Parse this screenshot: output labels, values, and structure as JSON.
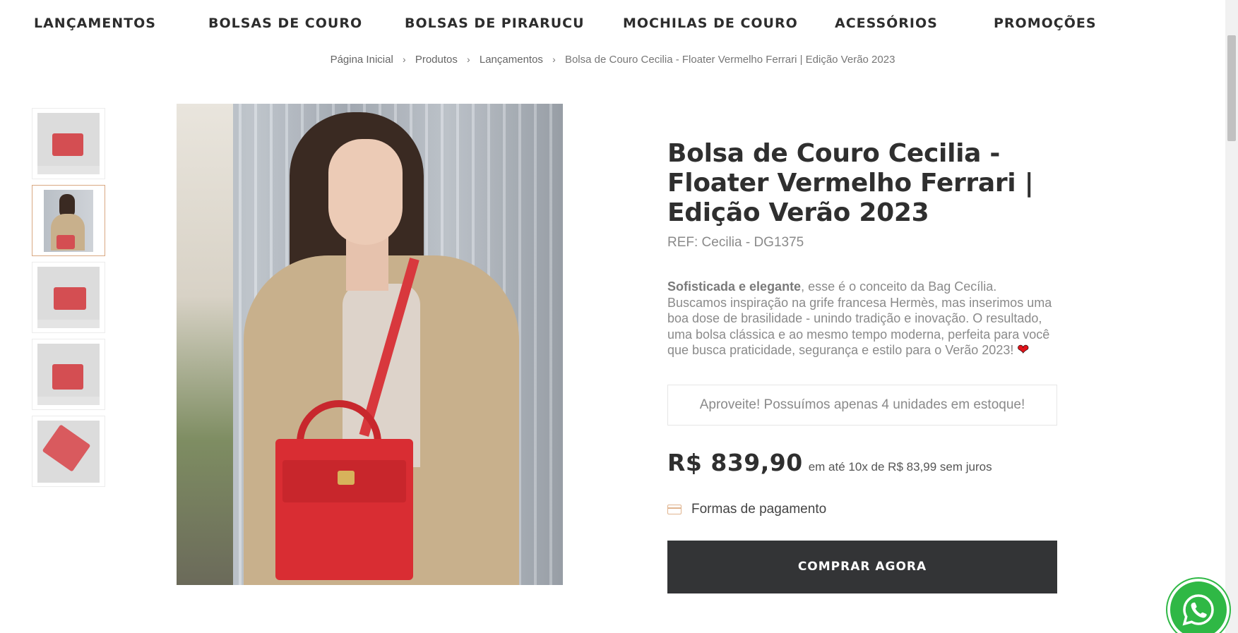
{
  "nav": {
    "items": [
      "LANÇAMENTOS",
      "BOLSAS DE COURO",
      "BOLSAS DE PIRARUCU",
      "MOCHILAS DE COURO",
      "ACESSÓRIOS",
      "PROMOÇÕES"
    ]
  },
  "breadcrumb": [
    "Página Inicial",
    "Produtos",
    "Lançamentos",
    "Bolsa de Couro Cecilia - Floater Vermelho Ferrari | Edição Verão 2023"
  ],
  "product": {
    "title": "Bolsa de Couro Cecilia - Floater Vermelho Ferrari | Edição Verão 2023",
    "ref": "REF: Cecilia - DG1375",
    "description_bold": "Sofisticada e elegante",
    "description_rest": ", esse é o conceito da Bag Cecília. Buscamos inspiração na grife francesa Hermès, mas inserimos uma boa dose de brasilidade - unindo tradição e inovação. O resultado, uma bolsa clássica e ao mesmo tempo moderna, perfeita para você que busca praticidade, segurança e estilo para o Verão 2023!",
    "heart_icon": "heart-icon",
    "stock_message": "Aproveite! Possuímos apenas 4 unidades em estoque!",
    "price": "R$ 839,90",
    "installments": "em até 10x de R$ 83,99 sem juros",
    "payment_label": "Formas de pagamento",
    "buy_button": "COMPRAR AGORA"
  },
  "gallery": {
    "thumbnail_count": 5,
    "active_index": 1
  },
  "colors": {
    "accent": "#d9a882",
    "button_bg": "#333436",
    "bag_red": "#d92d33",
    "whatsapp_green": "#2fb845"
  }
}
